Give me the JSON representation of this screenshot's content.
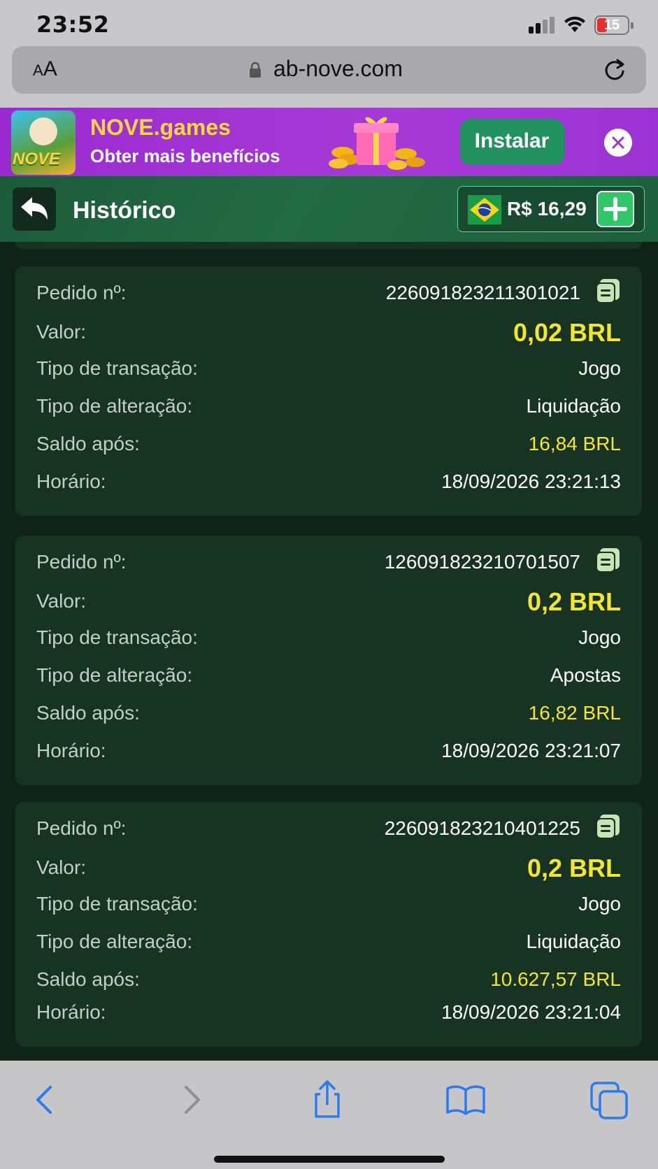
{
  "status": {
    "time": "23:52",
    "battery": "15"
  },
  "browser": {
    "text_size_label_small": "A",
    "text_size_label_big": "A",
    "url": "ab-nove.com"
  },
  "promo": {
    "logo_word": "NOVE",
    "title": "NOVE.games",
    "subtitle": "Obter mais benefícios",
    "install_label": "Instalar"
  },
  "header": {
    "title": "Histórico",
    "balance": "R$ 16,29"
  },
  "labels": {
    "order": "Pedido nº:",
    "amount": "Valor:",
    "transaction_type": "Tipo de transação:",
    "change_type": "Tipo de alteração:",
    "balance_after": "Saldo após:",
    "time": "Horário:"
  },
  "records": [
    {
      "order": "226091823211301021",
      "amount": "0,02 BRL",
      "transaction_type": "Jogo",
      "change_type": "Liquidação",
      "balance_after": "16,84 BRL",
      "time": "18/09/2026 23:21:13"
    },
    {
      "order": "126091823210701507",
      "amount": "0,2 BRL",
      "transaction_type": "Jogo",
      "change_type": "Apostas",
      "balance_after": "16,82 BRL",
      "time": "18/09/2026 23:21:07"
    },
    {
      "order": "226091823210401225",
      "amount": "0,2 BRL",
      "transaction_type": "Jogo",
      "change_type": "Liquidação",
      "balance_after": "10.627,57 BRL",
      "time": "18/09/2026 23:21:04"
    }
  ],
  "colors": {
    "accent_yellow": "#f4e62e",
    "install_green": "#20915f",
    "banner_purple": "#9b2bd0",
    "card_bg": "#173323",
    "ios_blue": "#2a7bf0"
  },
  "icons": {
    "back": "back-arrow-icon",
    "copy": "copy-icon",
    "add": "plus-icon",
    "close": "close-icon"
  }
}
